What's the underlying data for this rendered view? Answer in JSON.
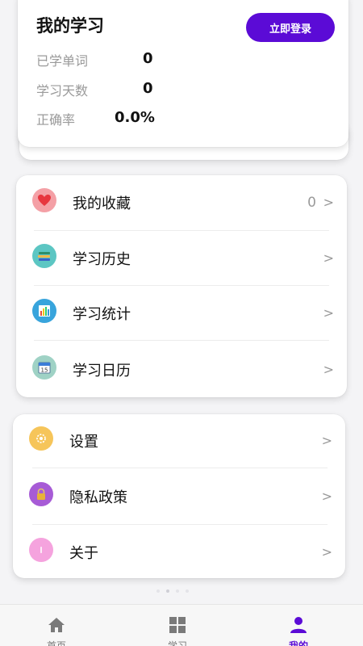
{
  "study": {
    "title": "我的学习",
    "login_label": "立即登录",
    "stats": [
      {
        "label": "已学单词",
        "value": "0"
      },
      {
        "label": "学习天数",
        "value": "0"
      },
      {
        "label": "正确率",
        "value": "0.0%"
      }
    ]
  },
  "menu1": [
    {
      "label": "我的收藏",
      "count": "0",
      "arrow": ">",
      "icon": "heart-icon",
      "icon_color": "#f4a0a6"
    },
    {
      "label": "学习历史",
      "arrow": ">",
      "icon": "books-icon",
      "icon_color": "#5cc6c3"
    },
    {
      "label": "学习统计",
      "arrow": ">",
      "icon": "bar-chart-icon",
      "icon_color": "#38a4dc"
    },
    {
      "label": "学习日历",
      "arrow": ">",
      "icon": "calendar-icon",
      "icon_color": "#9fd2c5"
    }
  ],
  "menu2": [
    {
      "label": "设置",
      "arrow": ">",
      "icon": "gear-icon",
      "icon_color": "#f6c55a"
    },
    {
      "label": "隐私政策",
      "arrow": ">",
      "icon": "lock-icon",
      "icon_color": "#a75bd6"
    },
    {
      "label": "关于",
      "arrow": ">",
      "icon": "info-icon",
      "icon_color": "#f5a3de"
    }
  ],
  "bottom_nav": [
    {
      "label": "首页",
      "icon": "home-icon"
    },
    {
      "label": "学习",
      "icon": "grid-icon"
    },
    {
      "label": "我的",
      "icon": "user-icon",
      "active": true
    }
  ],
  "colors": {
    "accent": "#5b0bd6",
    "background": "#f4f4f6"
  }
}
